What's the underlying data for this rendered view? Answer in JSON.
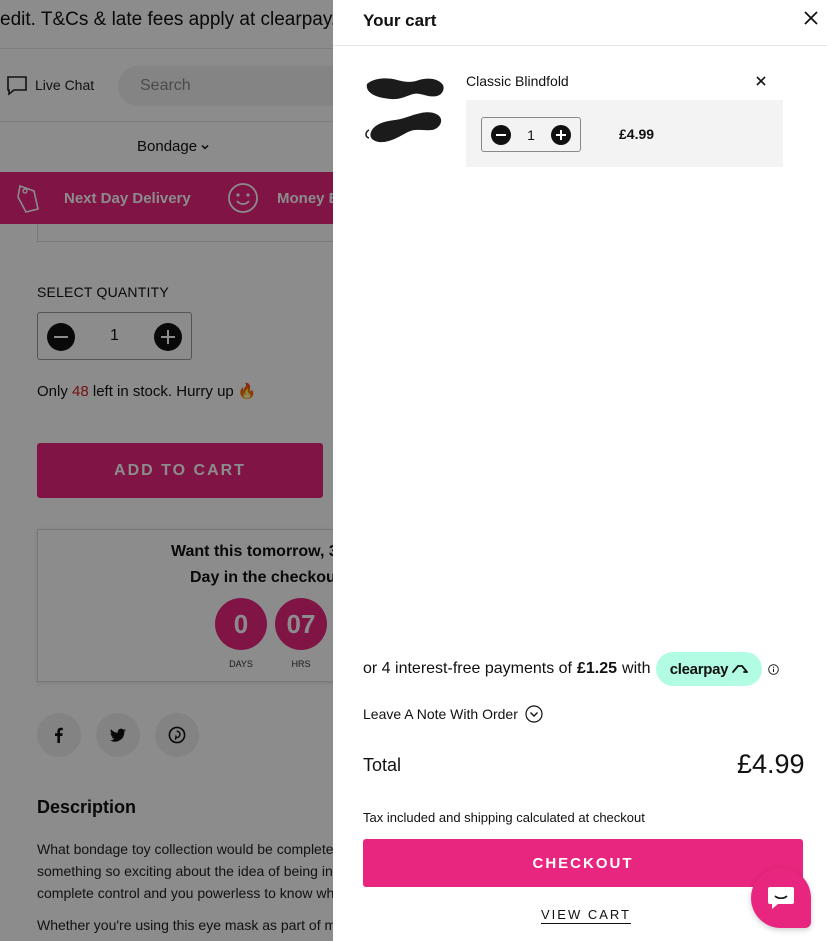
{
  "background": {
    "announcement": "edit. T&Cs & late fees apply at clearpay.co",
    "live_chat": "Live Chat",
    "search_placeholder": "Search",
    "nav_item": "Bondage",
    "promo": {
      "next_day": "Next Day Delivery",
      "money_back": "Money B"
    },
    "select_quantity": "SELECT QUANTITY",
    "quantity": "1",
    "stock_prefix": "Only",
    "stock_count": "48",
    "stock_suffix": "left in stock. Hurry up 🔥",
    "add_to_cart": "ADD TO CART",
    "tomorrow_line1": "Want this tomorrow, 3",
    "tomorrow_line2": "Day in the checkout",
    "countdown": [
      {
        "value": "0",
        "label": "DAYS"
      },
      {
        "value": "07",
        "label": "HRS"
      }
    ],
    "description_heading": "Description",
    "description_lines": [
      "What bondage toy collection would be complete",
      "something so exciting about the idea of being in",
      "complete control and you powerless to know wh"
    ],
    "description_line4": "Whether you're using this eye mask as part of m"
  },
  "cart": {
    "title": "Your cart",
    "item": {
      "name": "Classic Blindfold",
      "quantity": "1",
      "price": "£4.99"
    },
    "clearpay": {
      "prefix": "or 4 interest-free payments of",
      "amount": "£1.25",
      "with": "with",
      "brand": "clearpay"
    },
    "note_label": "Leave A Note With Order",
    "total_label": "Total",
    "total_value": "£4.99",
    "tax_note": "Tax included and shipping calculated at checkout",
    "checkout_label": "CHECKOUT",
    "view_cart_label": "VIEW CART"
  },
  "colors": {
    "brand_pink": "#e8267f",
    "clearpay_mint": "#b2fce4",
    "overlay": "rgba(0,0,0,0.45)"
  },
  "icons": [
    "chat-bubble-icon",
    "chevron-down-icon",
    "price-tag-icon",
    "smiley-icon",
    "facebook-icon",
    "twitter-icon",
    "pinterest-icon",
    "close-icon",
    "minus-icon",
    "plus-icon",
    "clearpay-arrows-icon",
    "info-icon",
    "chevron-circle-down-icon",
    "shopify-chat-icon"
  ]
}
